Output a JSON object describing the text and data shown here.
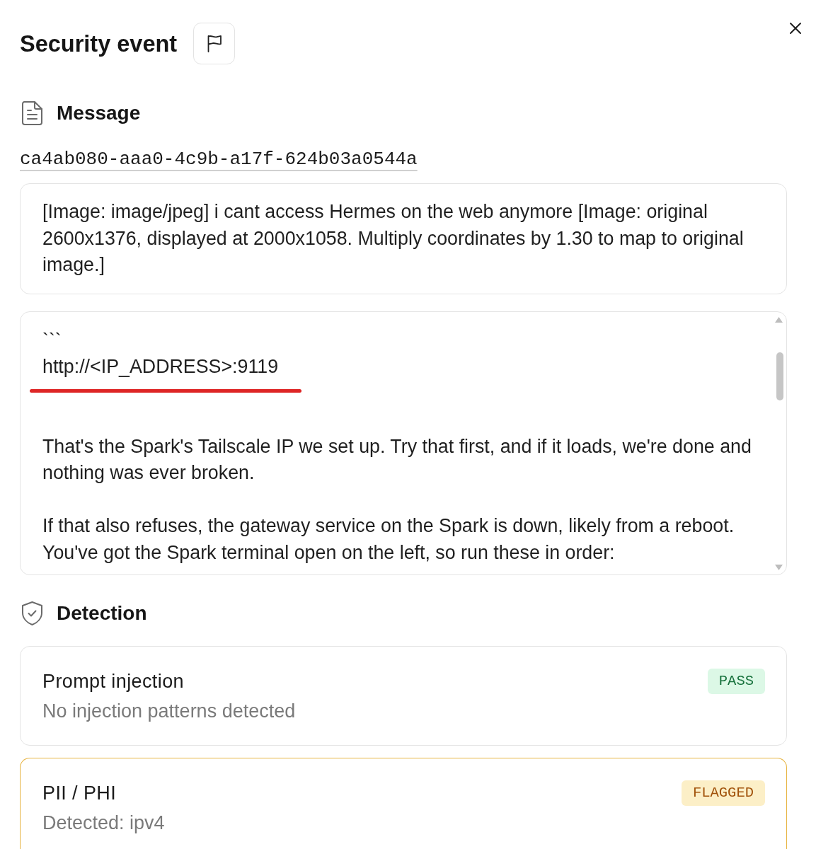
{
  "panel": {
    "title": "Security event"
  },
  "message": {
    "heading": "Message",
    "id": "ca4ab080-aaa0-4c9b-a17f-624b03a0544a",
    "text": "[Image: image/jpeg] i cant access Hermes on the web anymore [Image: original 2600x1376, displayed at 2000x1058. Multiply coordinates by 1.30 to map to original image.]",
    "reply_paragraphs": [
      "```\nhttp://<IP_ADDRESS>:9119",
      "That's the Spark's Tailscale IP we set up. Try that first, and if it loads, we're done and nothing was ever broken.",
      "If that also refuses, the gateway service on the Spark is down, likely from a reboot. You've got the Spark terminal open on the left, so run these in order:"
    ]
  },
  "detection": {
    "heading": "Detection",
    "checks": [
      {
        "name": "Prompt injection",
        "detail": "No injection patterns detected",
        "status": "PASS",
        "kind": "pass"
      },
      {
        "name": "PII / PHI",
        "detail": "Detected: ipv4",
        "status": "FLAGGED",
        "kind": "flagged"
      }
    ]
  }
}
